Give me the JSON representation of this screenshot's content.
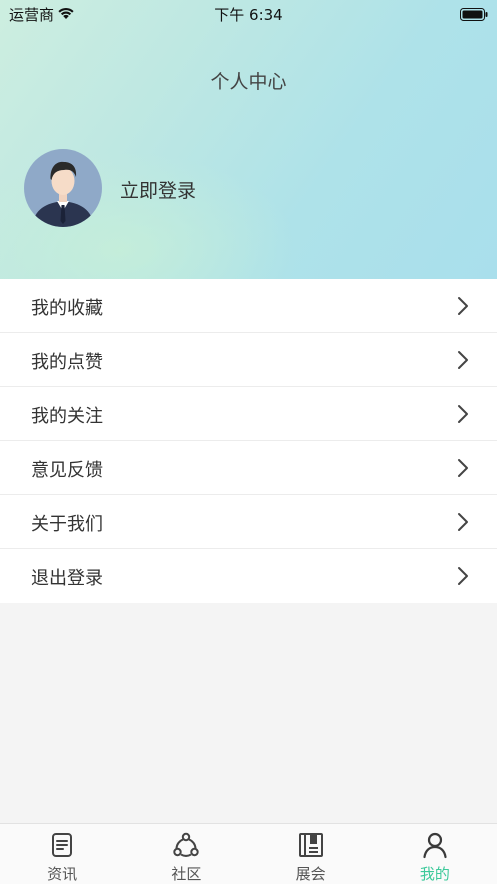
{
  "status_bar": {
    "carrier": "运营商",
    "time": "下午 6:34"
  },
  "header": {
    "title": "个人中心",
    "login_label": "立即登录"
  },
  "menu": {
    "items": [
      {
        "label": "我的收藏"
      },
      {
        "label": "我的点赞"
      },
      {
        "label": "我的关注"
      },
      {
        "label": "意见反馈"
      },
      {
        "label": "关于我们"
      },
      {
        "label": "退出登录"
      }
    ]
  },
  "tabbar": {
    "tabs": [
      {
        "label": "资讯",
        "icon": "news-icon"
      },
      {
        "label": "社区",
        "icon": "community-icon"
      },
      {
        "label": "展会",
        "icon": "exhibition-icon"
      },
      {
        "label": "我的",
        "icon": "profile-icon",
        "active": true
      }
    ],
    "active_color": "#3cc99a"
  }
}
